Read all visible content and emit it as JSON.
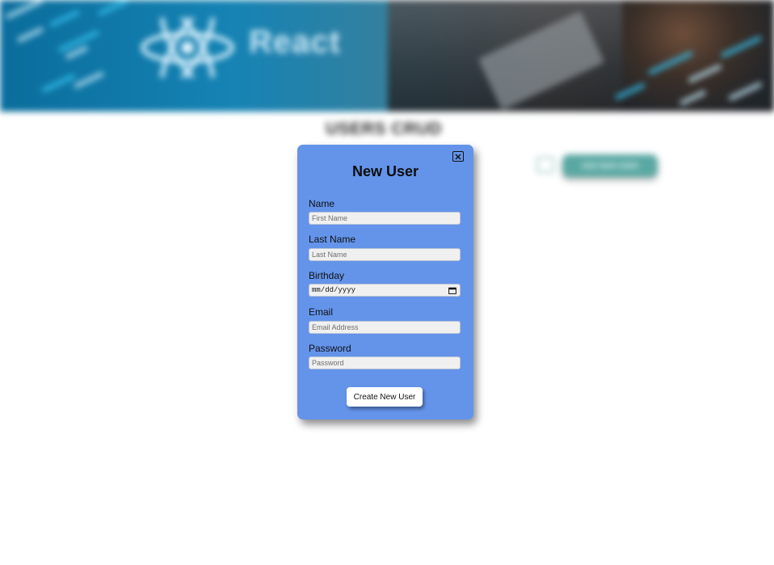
{
  "background": {
    "banner": {
      "brand_text": "React"
    },
    "page_title": "USERS CRUD",
    "add_button_label": "ADD NEW USER",
    "colors": {
      "banner_blue": "#1583b4",
      "add_button": "#5aa8a3"
    }
  },
  "modal": {
    "title": "New User",
    "close_icon": "close-icon",
    "fields": {
      "name": {
        "label": "Name",
        "placeholder": "First Name",
        "value": ""
      },
      "last_name": {
        "label": "Last Name",
        "placeholder": "Last Name",
        "value": ""
      },
      "birthday": {
        "label": "Birthday",
        "display": "mm/dd/yyyy",
        "icon": "calendar-icon"
      },
      "email": {
        "label": "Email",
        "placeholder": "Email Address",
        "value": ""
      },
      "password": {
        "label": "Password",
        "placeholder": "Password",
        "value": ""
      }
    },
    "submit_label": "Create New User",
    "colors": {
      "modal_bg": "#6494ea",
      "input_bg": "#f0f0f0",
      "button_bg": "#ffffff"
    }
  }
}
